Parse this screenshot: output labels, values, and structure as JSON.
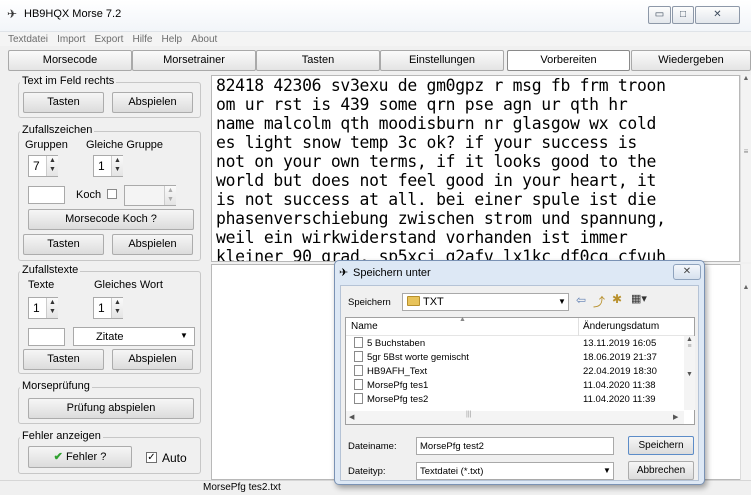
{
  "window": {
    "title": "HB9HQX Morse 7.2",
    "minimize": "▭",
    "maximize": "□",
    "close": "✕"
  },
  "menu": [
    "Textdatei",
    "Import",
    "Export",
    "Hilfe",
    "Help",
    "About"
  ],
  "tabs": [
    "Morsecode",
    "Morsetrainer",
    "Tasten",
    "Einstellungen",
    "Vorbereiten",
    "Wiedergeben"
  ],
  "active_tab": "Vorbereiten",
  "left": {
    "text_im_feld": {
      "title": "Text im Feld rechts",
      "tasten": "Tasten",
      "abspielen": "Abspielen"
    },
    "zufallszeichen": {
      "title": "Zufallszeichen",
      "gruppen_label": "Gruppen",
      "gleiche_label": "Gleiche Gruppe",
      "gruppen_value": "7",
      "gleiche_value": "1",
      "koch_label": "Koch",
      "morsecode_koch": "Morsecode Koch ?",
      "tasten": "Tasten",
      "abspielen": "Abspielen"
    },
    "zufallstexte": {
      "title": "Zufallstexte",
      "texte_label": "Texte",
      "gleiches_label": "Gleiches Wort",
      "texte_value": "1",
      "gleiches_value": "1",
      "select_value": "Zitate",
      "tasten": "Tasten",
      "abspielen": "Abspielen"
    },
    "morsepruefung": {
      "title": "Morseprüfung",
      "button": "Prüfung abspielen"
    },
    "fehler": {
      "title": "Fehler anzeigen",
      "button": "Fehler ?",
      "auto_label": "Auto",
      "auto_checked": true
    }
  },
  "main_text": [
    "82418 42306 sv3exu de gm0gpz r msg fb frm troon",
    "om ur rst is 439 some qrn pse agn ur qth hr",
    "name malcolm qth moodisburn nr glasgow wx cold",
    "es light snow temp 3c ok? if your success is",
    "not on your own terms, if it looks good to the",
    "world but does not feel good in your heart, it",
    "is not success at all. bei einer spule ist die",
    "phasenverschiebung zwischen strom und spannung,",
    "weil ein wirkwiderstand vorhanden ist immer",
    "kleiner 90 grad. sp5xcj g2afv lx1kc df0cg cfvuh"
  ],
  "status": {
    "filename": "MorsePfg tes2.txt"
  },
  "dialog": {
    "title": "Speichern unter",
    "speichern_in_label": "Speichern",
    "folder": "TXT",
    "col_name": "Name",
    "col_date": "Änderungsdatum",
    "files": [
      {
        "name": "5 Buchstaben",
        "date": "13.11.2019 16:05"
      },
      {
        "name": "5gr 5Bst worte gemischt",
        "date": "18.06.2019 21:37"
      },
      {
        "name": "HB9AFH_Text",
        "date": "22.04.2019 18:30"
      },
      {
        "name": "MorsePfg tes1",
        "date": "11.04.2020 11:38"
      },
      {
        "name": "MorsePfg tes2",
        "date": "11.04.2020 11:39"
      }
    ],
    "dateiname_label": "Dateiname:",
    "dateiname_value": "MorsePfg test2",
    "dateityp_label": "Dateityp:",
    "dateityp_value": "Textdatei (*.txt)",
    "save_button": "Speichern",
    "cancel_button": "Abbrechen"
  }
}
